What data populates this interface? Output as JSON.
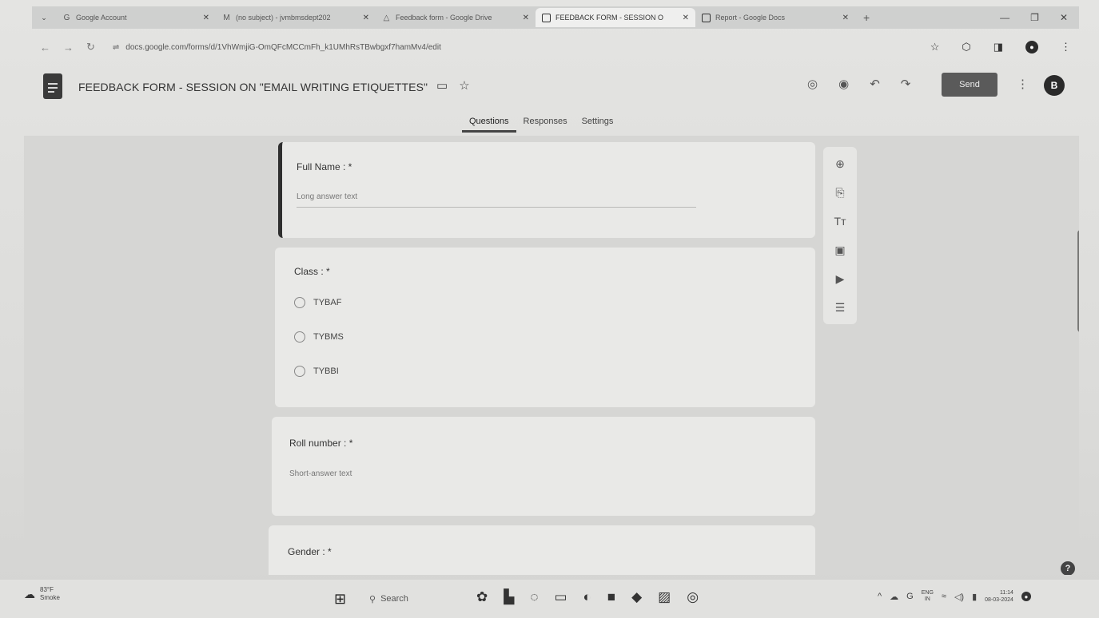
{
  "browser": {
    "tabs": [
      {
        "label": "Google Account",
        "icon": "google-icon",
        "active": false
      },
      {
        "label": "(no subject) - jvmbmsdept202",
        "icon": "gmail-icon",
        "active": false
      },
      {
        "label": "Feedback form - Google Drive",
        "icon": "drive-icon",
        "active": false
      },
      {
        "label": "FEEDBACK FORM - SESSION O",
        "icon": "forms-icon",
        "active": true
      },
      {
        "label": "Report - Google Docs",
        "icon": "docs-icon",
        "active": false
      }
    ],
    "url": "docs.google.com/forms/d/1VhWmjiG-OmQFcMCCmFh_k1UMhRsTBwbgxf7hamMv4/edit"
  },
  "form_header": {
    "title": "FEEDBACK FORM - SESSION ON \"EMAIL WRITING ETIQUETTES\"",
    "send_label": "Send",
    "avatar_letter": "B",
    "tabs": [
      {
        "label": "Questions",
        "active": true
      },
      {
        "label": "Responses",
        "active": false
      },
      {
        "label": "Settings",
        "active": false
      }
    ]
  },
  "questions": [
    {
      "title": "Full Name : *",
      "hint": "Long answer text",
      "type": "paragraph"
    },
    {
      "title": "Class : *",
      "type": "multiple_choice",
      "options": [
        "TYBAF",
        "TYBMS",
        "TYBBI"
      ]
    },
    {
      "title": "Roll number : *",
      "hint": "Short-answer text",
      "type": "short"
    },
    {
      "title": "Gender : *",
      "type": "partial"
    }
  ],
  "side_toolbar": [
    "add-question-icon",
    "import-questions-icon",
    "add-title-icon",
    "add-image-icon",
    "add-video-icon",
    "add-section-icon"
  ],
  "taskbar": {
    "weather_temp": "83°F",
    "weather_desc": "Smoke",
    "search_label": "Search",
    "lang_top": "ENG",
    "lang_bottom": "IN",
    "time": "11:14",
    "date": "08-03-2024"
  }
}
